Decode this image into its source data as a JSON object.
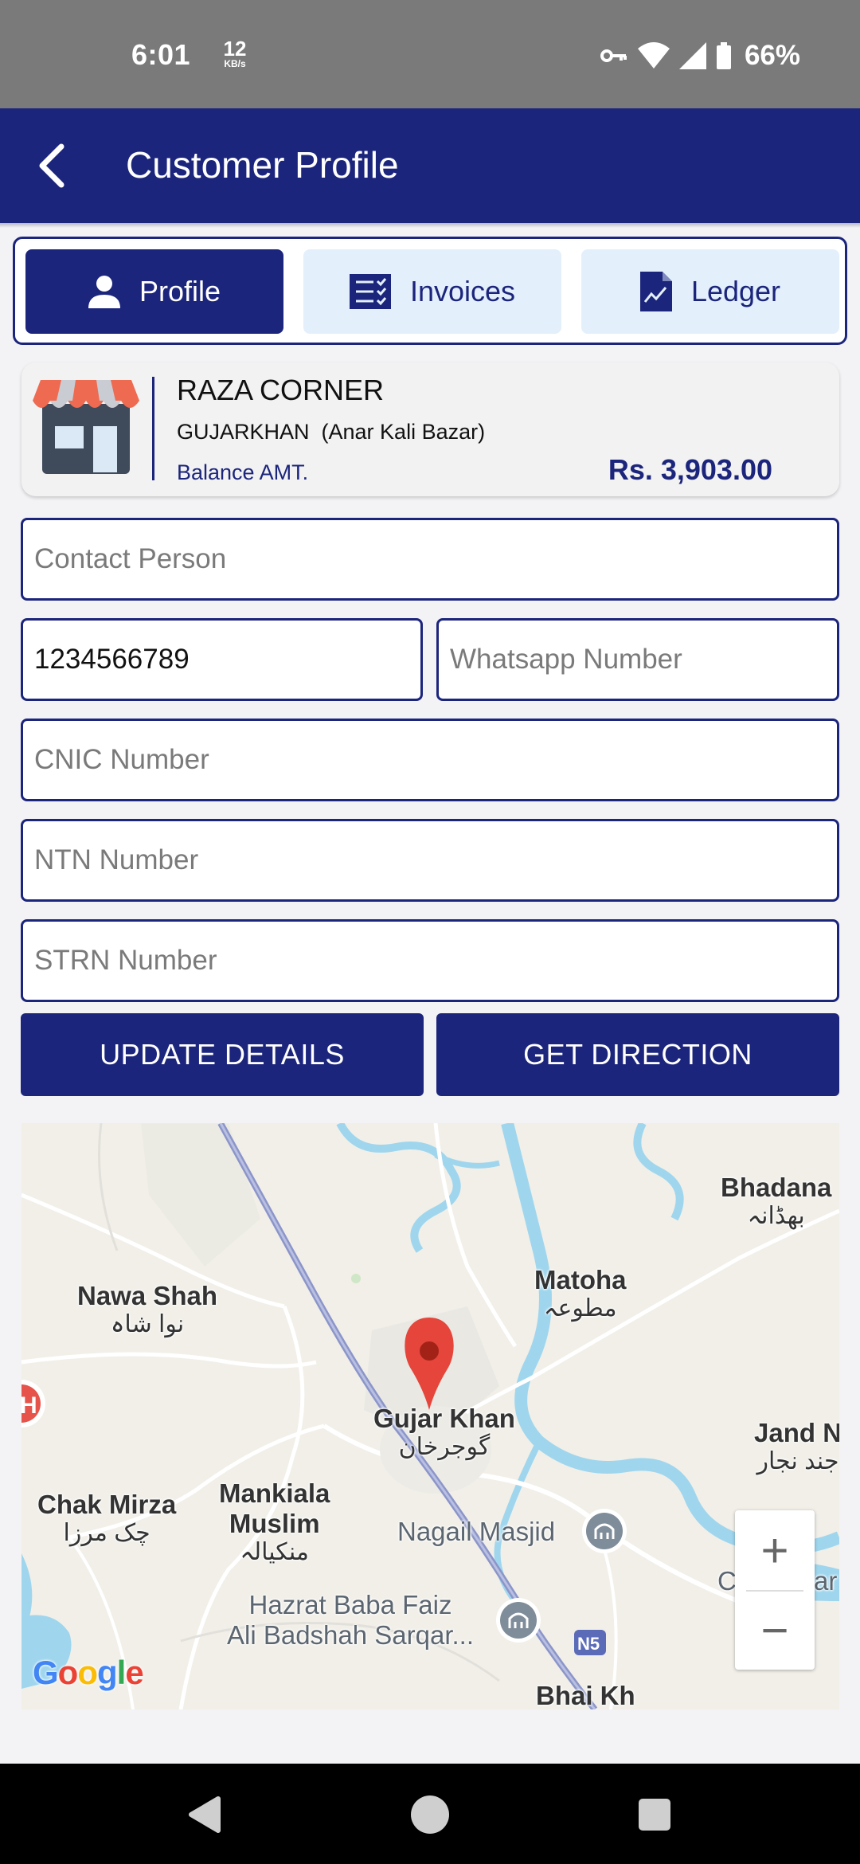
{
  "status_bar": {
    "time": "6:01",
    "net_speed_value": "12",
    "net_speed_unit": "KB/s",
    "battery": "66%",
    "icons": [
      "vpn-key-icon",
      "wifi-icon",
      "signal-icon",
      "battery-icon"
    ]
  },
  "app_bar": {
    "title": "Customer Profile",
    "background": "#1c257c"
  },
  "tabs": [
    {
      "label": "Profile",
      "icon": "person-icon",
      "active": true
    },
    {
      "label": "Invoices",
      "icon": "invoice-list-icon",
      "active": false
    },
    {
      "label": "Ledger",
      "icon": "ledger-chart-icon",
      "active": false
    }
  ],
  "customer": {
    "name": "RAZA CORNER",
    "city": "GUJARKHAN  (Anar Kali Bazar)",
    "balance_label": "Balance AMT.",
    "balance_value": "Rs. 3,903.00",
    "icon": "shop-icon"
  },
  "form": {
    "contact_person": {
      "value": "",
      "placeholder": "Contact Person"
    },
    "phone": {
      "value": "1234566789",
      "placeholder": ""
    },
    "whatsapp": {
      "value": "",
      "placeholder": "Whatsapp Number"
    },
    "cnic": {
      "value": "",
      "placeholder": "CNIC Number"
    },
    "ntn": {
      "value": "",
      "placeholder": "NTN Number"
    },
    "strn": {
      "value": "",
      "placeholder": "STRN Number"
    }
  },
  "actions": {
    "update_label": "UPDATE DETAILS",
    "direction_label": "GET DIRECTION"
  },
  "map": {
    "labels": {
      "bhadana_en": "Bhadana",
      "bhadana_ur": "بھڈانہ",
      "matoha_en": "Matoha",
      "matoha_ur": "مطوعہ",
      "nawa_shah_en": "Nawa Shah",
      "nawa_shah_ur": "نوا شاہ",
      "gujar_khan_en": "Gujar Khan",
      "gujar_khan_ur": "گوجرخان",
      "jand_en": "Jand N",
      "jand_ur": "جند نجار",
      "chak_mirza_en": "Chak Mirza",
      "chak_mirza_ur": "چک مرزا",
      "mankiala_en": "Mankiala",
      "mankiala_en2": "Muslim",
      "mankiala_ur": "منکیالہ",
      "nagail_masjid": "Nagail Masjid",
      "chak_jhang": "Chak Jhar",
      "hazrat_1": "Hazrat Baba Faiz",
      "hazrat_2": "Ali Badshah Sarqar...",
      "road_shield": "N5",
      "bottom_partial": "Bhai Kh"
    },
    "zoom_in": "+",
    "zoom_out": "−",
    "attribution": "Google",
    "water_color": "#9fd6ee",
    "road_color": "#8b95c9"
  },
  "nav_bar": {
    "icons": [
      "back-triangle-icon",
      "home-circle-icon",
      "recents-square-icon"
    ]
  }
}
